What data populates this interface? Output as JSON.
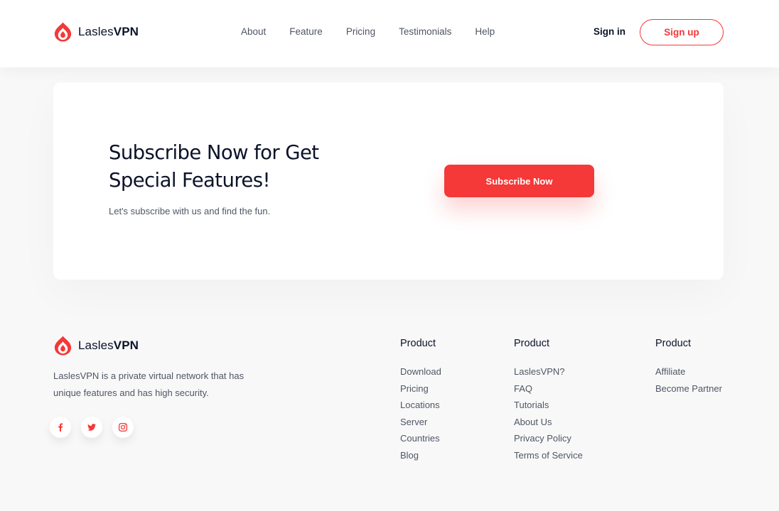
{
  "brand": {
    "name_light": "Lasles",
    "name_bold": "VPN",
    "accent": "#F53838",
    "logo_icon": "flame-logo-icon"
  },
  "nav": {
    "items": [
      "About",
      "Feature",
      "Pricing",
      "Testimonials",
      "Help"
    ]
  },
  "auth": {
    "signin_label": "Sign in",
    "signup_label": "Sign up"
  },
  "subscribe": {
    "title": "Subscribe Now for Get Special Features!",
    "subtitle": "Let's subscribe with us and find the fun.",
    "button_label": "Subscribe Now"
  },
  "footer": {
    "description": "LaslesVPN is a private virtual network that has unique features and has high security.",
    "socials": [
      "facebook-icon",
      "twitter-icon",
      "instagram-icon"
    ],
    "columns": [
      {
        "title": "Product",
        "links": [
          "Download",
          "Pricing",
          "Locations",
          "Server",
          "Countries",
          "Blog"
        ]
      },
      {
        "title": "Product",
        "links": [
          "LaslesVPN?",
          "FAQ",
          "Tutorials",
          "About Us",
          "Privacy Policy",
          "Terms of Service"
        ]
      },
      {
        "title": "Product",
        "links": [
          "Affiliate",
          "Become Partner"
        ]
      }
    ]
  }
}
